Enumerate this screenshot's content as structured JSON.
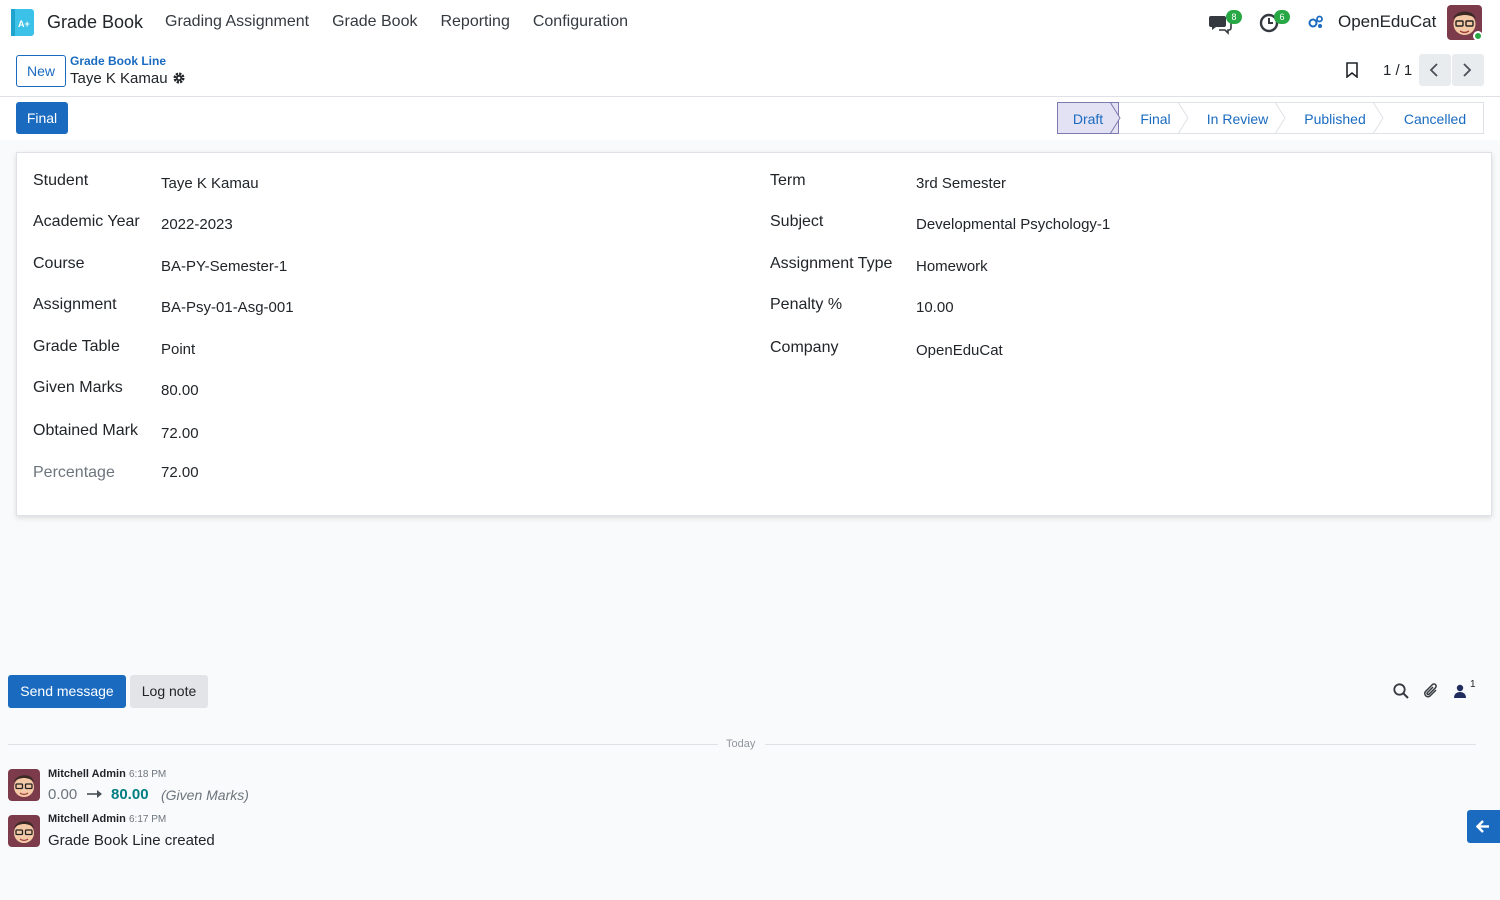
{
  "app": {
    "title": "Grade Book",
    "menu": [
      "Grading Assignment",
      "Grade Book",
      "Reporting",
      "Configuration"
    ],
    "messages_badge": "8",
    "activities_badge": "6",
    "company": "OpenEduCat"
  },
  "control": {
    "new_label": "New",
    "breadcrumb_parent": "Grade Book Line",
    "breadcrumb_current": "Taye K Kamau",
    "pager": "1 / 1"
  },
  "status": {
    "action_button": "Final",
    "stages": [
      "Draft",
      "Final",
      "In Review",
      "Published",
      "Cancelled"
    ],
    "active_stage": "Draft"
  },
  "form": {
    "left": [
      {
        "label": "Student",
        "value": "Taye K Kamau"
      },
      {
        "label": "Academic Year",
        "value": "2022-2023"
      },
      {
        "label": "Course",
        "value": "BA-PY-Semester-1"
      },
      {
        "label": "Assignment",
        "value": "BA-Psy-01-Asg-001"
      },
      {
        "label": "Grade Table",
        "value": "Point"
      },
      {
        "label": "Given Marks",
        "value": "80.00"
      },
      {
        "label": "Obtained Mark",
        "value": "72.00"
      },
      {
        "label": "Percentage",
        "value": "72.00"
      }
    ],
    "right": [
      {
        "label": "Term",
        "value": "3rd Semester"
      },
      {
        "label": "Subject",
        "value": "Developmental Psychology-1"
      },
      {
        "label": "Assignment Type",
        "value": "Homework"
      },
      {
        "label": "Penalty %",
        "value": "10.00"
      },
      {
        "label": "Company",
        "value": "OpenEduCat"
      }
    ]
  },
  "chatter": {
    "send_message": "Send message",
    "log_note": "Log note",
    "followers_count": "1",
    "day_separator": "Today",
    "messages": [
      {
        "author": "Mitchell Admin",
        "time": "6:18 PM",
        "old_value": "0.00",
        "new_value": "80.00",
        "field": "(Given Marks)"
      },
      {
        "author": "Mitchell Admin",
        "time": "6:17 PM",
        "body": "Grade Book Line created"
      }
    ]
  },
  "colors": {
    "primary": "#1a6bc0",
    "badge": "#28a745",
    "tracking_new": "#017e84"
  }
}
